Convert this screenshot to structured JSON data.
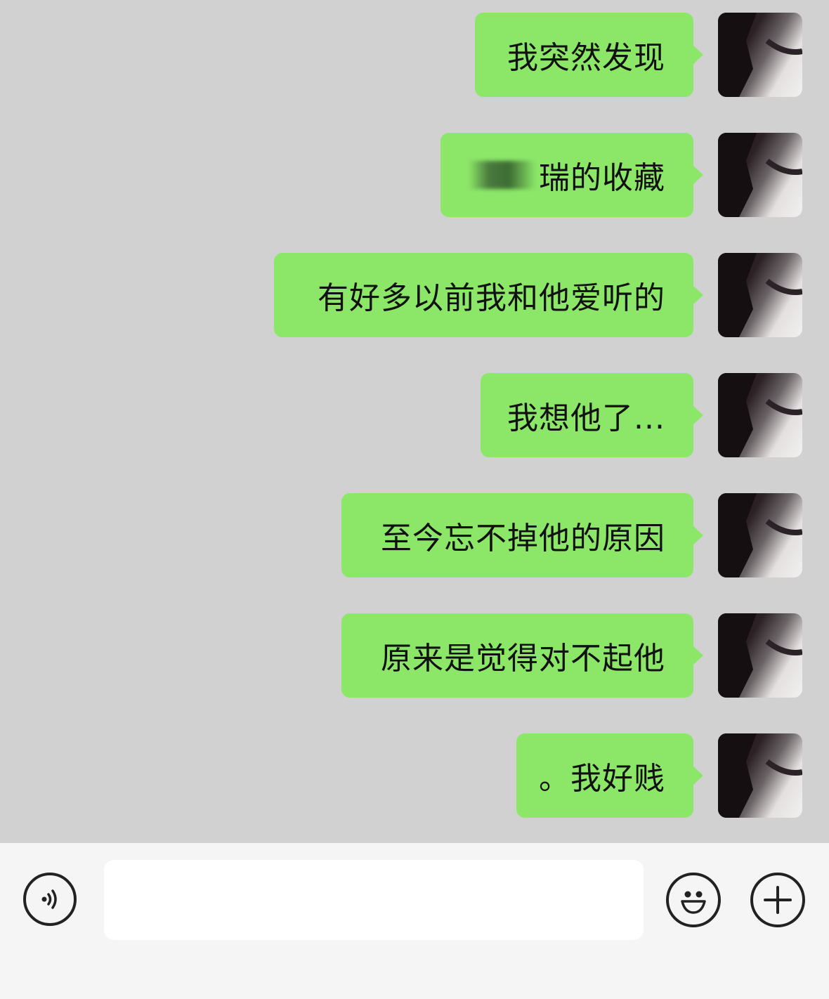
{
  "messages": [
    {
      "text": "我突然发现"
    },
    {
      "prefix_obscured": true,
      "text": "瑞的收藏"
    },
    {
      "text": "有好多以前我和他爱听的"
    },
    {
      "text": "我想他了..."
    },
    {
      "text": "至今忘不掉他的原因"
    },
    {
      "text": "原来是觉得对不起他"
    },
    {
      "text": "。我好贱"
    }
  ],
  "input": {
    "value": "",
    "placeholder": ""
  },
  "icons": {
    "voice": "voice-icon",
    "emoji": "emoji-icon",
    "plus": "plus-icon"
  },
  "colors": {
    "bubble": "#8ce769",
    "chat_bg": "#d1d1d1",
    "input_bar_bg": "#f5f5f5"
  }
}
